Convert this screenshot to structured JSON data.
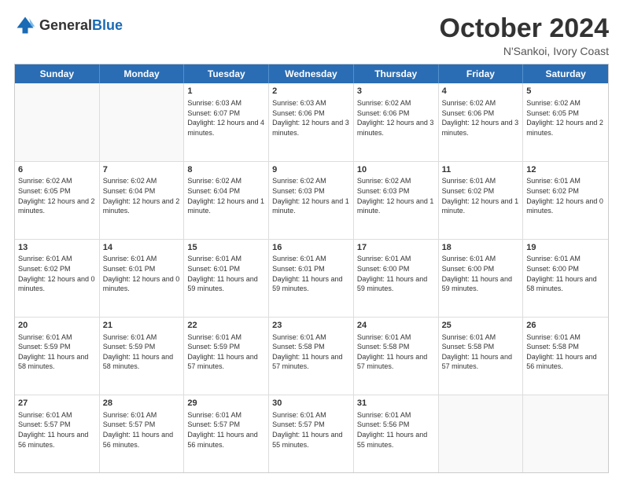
{
  "logo": {
    "general": "General",
    "blue": "Blue"
  },
  "title": {
    "month": "October 2024",
    "location": "N'Sankoi, Ivory Coast"
  },
  "header_days": [
    "Sunday",
    "Monday",
    "Tuesday",
    "Wednesday",
    "Thursday",
    "Friday",
    "Saturday"
  ],
  "weeks": [
    [
      {
        "day": "",
        "text": ""
      },
      {
        "day": "",
        "text": ""
      },
      {
        "day": "1",
        "text": "Sunrise: 6:03 AM\nSunset: 6:07 PM\nDaylight: 12 hours and 4 minutes."
      },
      {
        "day": "2",
        "text": "Sunrise: 6:03 AM\nSunset: 6:06 PM\nDaylight: 12 hours and 3 minutes."
      },
      {
        "day": "3",
        "text": "Sunrise: 6:02 AM\nSunset: 6:06 PM\nDaylight: 12 hours and 3 minutes."
      },
      {
        "day": "4",
        "text": "Sunrise: 6:02 AM\nSunset: 6:06 PM\nDaylight: 12 hours and 3 minutes."
      },
      {
        "day": "5",
        "text": "Sunrise: 6:02 AM\nSunset: 6:05 PM\nDaylight: 12 hours and 2 minutes."
      }
    ],
    [
      {
        "day": "6",
        "text": "Sunrise: 6:02 AM\nSunset: 6:05 PM\nDaylight: 12 hours and 2 minutes."
      },
      {
        "day": "7",
        "text": "Sunrise: 6:02 AM\nSunset: 6:04 PM\nDaylight: 12 hours and 2 minutes."
      },
      {
        "day": "8",
        "text": "Sunrise: 6:02 AM\nSunset: 6:04 PM\nDaylight: 12 hours and 1 minute."
      },
      {
        "day": "9",
        "text": "Sunrise: 6:02 AM\nSunset: 6:03 PM\nDaylight: 12 hours and 1 minute."
      },
      {
        "day": "10",
        "text": "Sunrise: 6:02 AM\nSunset: 6:03 PM\nDaylight: 12 hours and 1 minute."
      },
      {
        "day": "11",
        "text": "Sunrise: 6:01 AM\nSunset: 6:02 PM\nDaylight: 12 hours and 1 minute."
      },
      {
        "day": "12",
        "text": "Sunrise: 6:01 AM\nSunset: 6:02 PM\nDaylight: 12 hours and 0 minutes."
      }
    ],
    [
      {
        "day": "13",
        "text": "Sunrise: 6:01 AM\nSunset: 6:02 PM\nDaylight: 12 hours and 0 minutes."
      },
      {
        "day": "14",
        "text": "Sunrise: 6:01 AM\nSunset: 6:01 PM\nDaylight: 12 hours and 0 minutes."
      },
      {
        "day": "15",
        "text": "Sunrise: 6:01 AM\nSunset: 6:01 PM\nDaylight: 11 hours and 59 minutes."
      },
      {
        "day": "16",
        "text": "Sunrise: 6:01 AM\nSunset: 6:01 PM\nDaylight: 11 hours and 59 minutes."
      },
      {
        "day": "17",
        "text": "Sunrise: 6:01 AM\nSunset: 6:00 PM\nDaylight: 11 hours and 59 minutes."
      },
      {
        "day": "18",
        "text": "Sunrise: 6:01 AM\nSunset: 6:00 PM\nDaylight: 11 hours and 59 minutes."
      },
      {
        "day": "19",
        "text": "Sunrise: 6:01 AM\nSunset: 6:00 PM\nDaylight: 11 hours and 58 minutes."
      }
    ],
    [
      {
        "day": "20",
        "text": "Sunrise: 6:01 AM\nSunset: 5:59 PM\nDaylight: 11 hours and 58 minutes."
      },
      {
        "day": "21",
        "text": "Sunrise: 6:01 AM\nSunset: 5:59 PM\nDaylight: 11 hours and 58 minutes."
      },
      {
        "day": "22",
        "text": "Sunrise: 6:01 AM\nSunset: 5:59 PM\nDaylight: 11 hours and 57 minutes."
      },
      {
        "day": "23",
        "text": "Sunrise: 6:01 AM\nSunset: 5:58 PM\nDaylight: 11 hours and 57 minutes."
      },
      {
        "day": "24",
        "text": "Sunrise: 6:01 AM\nSunset: 5:58 PM\nDaylight: 11 hours and 57 minutes."
      },
      {
        "day": "25",
        "text": "Sunrise: 6:01 AM\nSunset: 5:58 PM\nDaylight: 11 hours and 57 minutes."
      },
      {
        "day": "26",
        "text": "Sunrise: 6:01 AM\nSunset: 5:58 PM\nDaylight: 11 hours and 56 minutes."
      }
    ],
    [
      {
        "day": "27",
        "text": "Sunrise: 6:01 AM\nSunset: 5:57 PM\nDaylight: 11 hours and 56 minutes."
      },
      {
        "day": "28",
        "text": "Sunrise: 6:01 AM\nSunset: 5:57 PM\nDaylight: 11 hours and 56 minutes."
      },
      {
        "day": "29",
        "text": "Sunrise: 6:01 AM\nSunset: 5:57 PM\nDaylight: 11 hours and 56 minutes."
      },
      {
        "day": "30",
        "text": "Sunrise: 6:01 AM\nSunset: 5:57 PM\nDaylight: 11 hours and 55 minutes."
      },
      {
        "day": "31",
        "text": "Sunrise: 6:01 AM\nSunset: 5:56 PM\nDaylight: 11 hours and 55 minutes."
      },
      {
        "day": "",
        "text": ""
      },
      {
        "day": "",
        "text": ""
      }
    ]
  ]
}
